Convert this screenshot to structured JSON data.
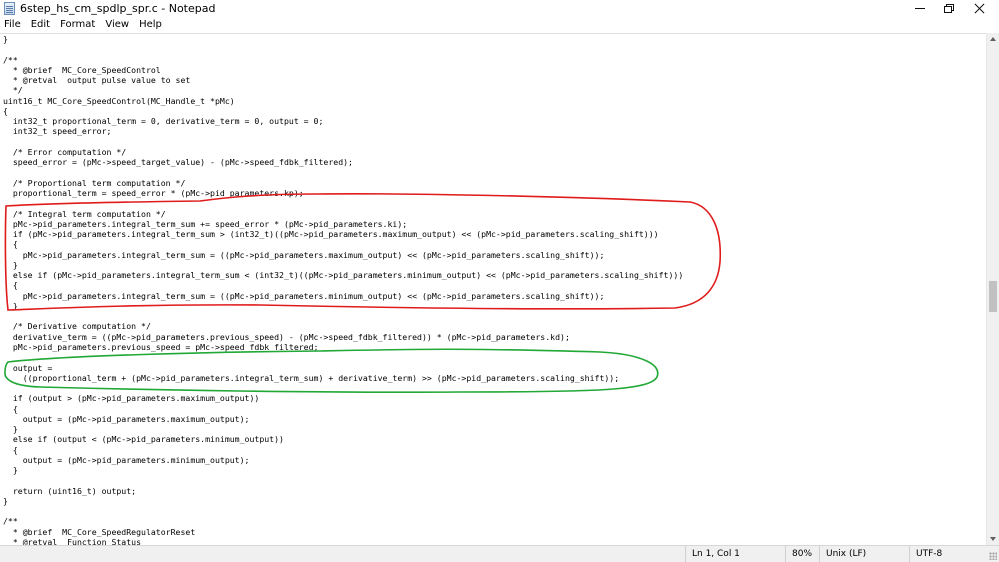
{
  "window": {
    "title": "6step_hs_cm_spdlp_spr.c - Notepad",
    "icon": "notepad-icon",
    "controls": [
      "minimize-icon",
      "restore-icon",
      "close-icon"
    ]
  },
  "menu": {
    "items": [
      {
        "label": "File"
      },
      {
        "label": "Edit"
      },
      {
        "label": "Format"
      },
      {
        "label": "View"
      },
      {
        "label": "Help"
      }
    ]
  },
  "editor": {
    "lines": [
      "}",
      "",
      "/**",
      "  * @brief  MC_Core_SpeedControl",
      "  * @retval  output pulse value to set",
      "  */",
      "uint16_t MC_Core_SpeedControl(MC_Handle_t *pMc)",
      "{",
      "  int32_t proportional_term = 0, derivative_term = 0, output = 0;",
      "  int32_t speed_error;",
      "",
      "  /* Error computation */",
      "  speed_error = (pMc->speed_target_value) - (pMc->speed_fdbk_filtered);",
      "",
      "  /* Proportional term computation */",
      "  proportional_term = speed_error * (pMc->pid_parameters.kp);",
      "",
      "  /* Integral term computation */",
      "  pMc->pid_parameters.integral_term_sum += speed_error * (pMc->pid_parameters.ki);",
      "  if (pMc->pid_parameters.integral_term_sum > (int32_t)((pMc->pid_parameters.maximum_output) << (pMc->pid_parameters.scaling_shift)))",
      "  {",
      "    pMc->pid_parameters.integral_term_sum = ((pMc->pid_parameters.maximum_output) << (pMc->pid_parameters.scaling_shift));",
      "  }",
      "  else if (pMc->pid_parameters.integral_term_sum < (int32_t)((pMc->pid_parameters.minimum_output) << (pMc->pid_parameters.scaling_shift)))",
      "  {",
      "    pMc->pid_parameters.integral_term_sum = ((pMc->pid_parameters.minimum_output) << (pMc->pid_parameters.scaling_shift));",
      "  }",
      "",
      "  /* Derivative computation */",
      "  derivative_term = ((pMc->pid_parameters.previous_speed) - (pMc->speed_fdbk_filtered)) * (pMc->pid_parameters.kd);",
      "  pMc->pid_parameters.previous_speed = pMc->speed_fdbk_filtered;",
      "",
      "  output =",
      "    ((proportional_term + (pMc->pid_parameters.integral_term_sum) + derivative_term) >> (pMc->pid_parameters.scaling_shift));",
      "",
      "  if (output > (pMc->pid_parameters.maximum_output))",
      "  {",
      "    output = (pMc->pid_parameters.maximum_output);",
      "  }",
      "  else if (output < (pMc->pid_parameters.minimum_output))",
      "  {",
      "    output = (pMc->pid_parameters.minimum_output);",
      "  }",
      "",
      "  return (uint16_t) output;",
      "}",
      "",
      "/**",
      "  * @brief  MC_Core_SpeedRegulatorReset",
      "  * @retval  Function Status"
    ],
    "annotations": [
      {
        "name": "integral-term-highlight",
        "color": "#e01b1b"
      },
      {
        "name": "output-computation-highlight",
        "color": "#21a836"
      }
    ]
  },
  "statusbar": {
    "position": "Ln 1, Col 1",
    "zoom": "80%",
    "line_ending": "Unix (LF)",
    "encoding": "UTF-8"
  }
}
